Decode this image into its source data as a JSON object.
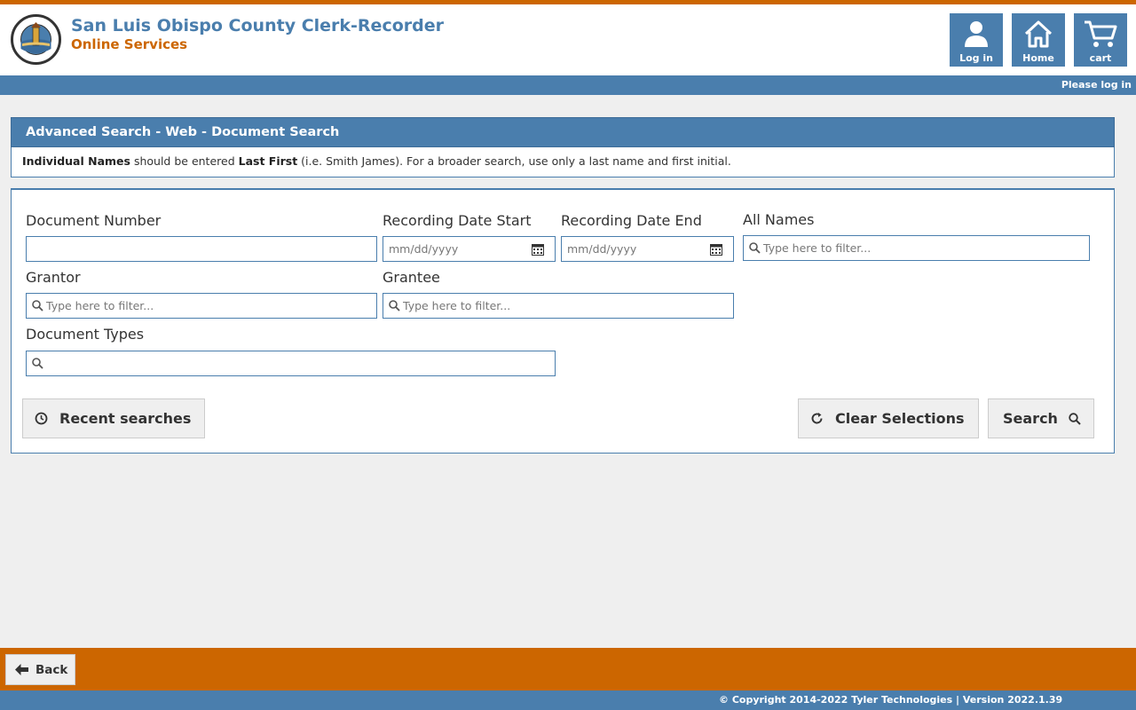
{
  "header": {
    "title": "San Luis Obispo County Clerk-Recorder",
    "subtitle": "Online Services",
    "buttons": {
      "login": "Log in",
      "home": "Home",
      "cart": "cart"
    },
    "login_status": "Please log in"
  },
  "panel": {
    "title": "Advanced Search - Web - Document Search",
    "notice": {
      "bold1": "Individual Names",
      "text1": " should be entered ",
      "bold2": "Last First",
      "text2": " (i.e. Smith James). For a broader search, use only a last name and first initial."
    }
  },
  "form": {
    "document_number": {
      "label": "Document Number",
      "value": "",
      "placeholder": ""
    },
    "recording_date_start": {
      "label": "Recording Date Start",
      "value": "",
      "placeholder": "mm/dd/yyyy"
    },
    "recording_date_end": {
      "label": "Recording Date End",
      "value": "",
      "placeholder": "mm/dd/yyyy"
    },
    "all_names": {
      "label": "All Names",
      "value": "",
      "placeholder": "Type here to filter..."
    },
    "grantor": {
      "label": "Grantor",
      "value": "",
      "placeholder": "Type here to filter..."
    },
    "grantee": {
      "label": "Grantee",
      "value": "",
      "placeholder": "Type here to filter..."
    },
    "document_types": {
      "label": "Document Types",
      "value": "",
      "placeholder": ""
    }
  },
  "actions": {
    "recent_searches": "Recent searches",
    "clear_selections": "Clear Selections",
    "search": "Search"
  },
  "footer": {
    "back": "Back",
    "copyright": "© Copyright 2014-2022 Tyler Technologies | Version 2022.1.39"
  },
  "colors": {
    "accent_orange": "#cc6600",
    "accent_blue": "#4a7ead",
    "background": "#efefef"
  },
  "icons": [
    "county-seal-logo",
    "user-icon",
    "home-icon",
    "cart-icon",
    "calendar-icon",
    "search-icon",
    "clock-icon",
    "refresh-icon",
    "arrow-left-icon"
  ]
}
